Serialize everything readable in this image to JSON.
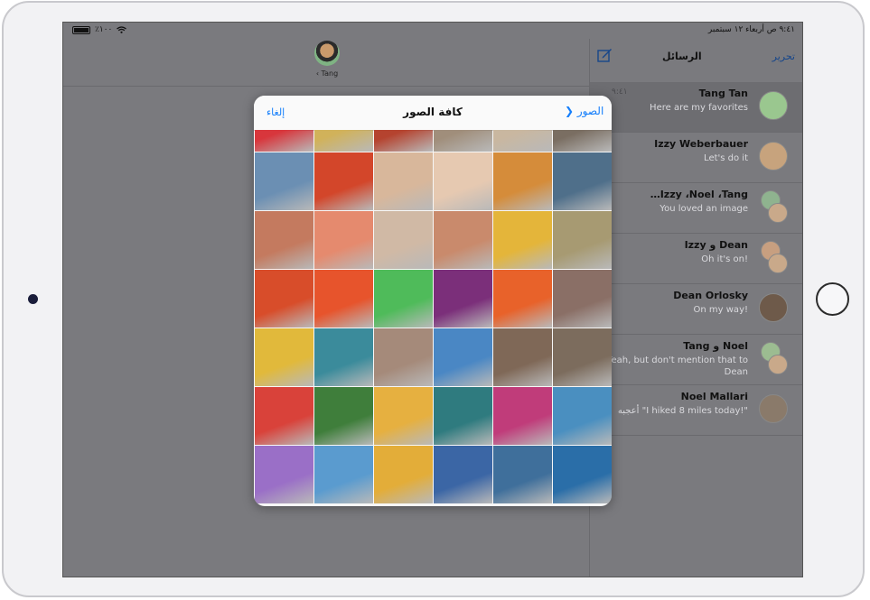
{
  "status_bar": {
    "battery": "٪١٠٠",
    "datetime": "٩:٤١ ص  أربعاء ١٢ سبتمبر"
  },
  "conversation": {
    "contact_name": "‹ Tang"
  },
  "list_header": {
    "title": "الرسائل",
    "edit": "تحرير",
    "compose_icon": "compose-icon"
  },
  "messages": [
    {
      "name": "Tang Tan",
      "preview": "Here are my favorites",
      "time": "٩:٤١",
      "selected": true,
      "avatar_color": "#9ac78f",
      "group": false
    },
    {
      "name": "Izzy Weberbauer",
      "preview": "Let's do it",
      "time": "",
      "selected": false,
      "avatar_color": "#c7a37d",
      "group": false
    },
    {
      "name": "…Izzy ،Noel ،Tang",
      "preview": "You loved an image",
      "time": "",
      "selected": false,
      "avatar_color": "#8fb38f",
      "group": true
    },
    {
      "name": "Izzy و Dean",
      "preview": "Oh it's on!",
      "time": "",
      "selected": false,
      "avatar_color": "#c79f80",
      "group": true
    },
    {
      "name": "Dean Orlosky",
      "preview": "On my way!",
      "time": "",
      "selected": false,
      "avatar_color": "#6e5a4a",
      "group": false
    },
    {
      "name": "Tang و Noel",
      "preview": "Yeah, but don't mention that to Dean",
      "time": "",
      "selected": false,
      "avatar_color": "#9cbc91",
      "group": true
    },
    {
      "name": "Noel Mallari",
      "preview": "أعجبه \"I hiked 8 miles today!\"",
      "time": "",
      "selected": false,
      "avatar_color": "#8a7a6a",
      "group": false
    }
  ],
  "photo_picker": {
    "back_label": "الصور",
    "title": "كافة الصور",
    "cancel_label": "إلغاء"
  },
  "photos": [
    "#7a6e62",
    "#c9b7a0",
    "#a08e7b",
    "#b5432f",
    "#d1b25a",
    "#d8363c",
    "#4f6f8a",
    "#d58c3a",
    "#e6c9b1",
    "#d8b79b",
    "#d3462a",
    "#6b8fb3",
    "#a79a72",
    "#e4b53a",
    "#c98a6c",
    "#d0b9a5",
    "#e58a6e",
    "#c47a5f",
    "#8a6f66",
    "#e8622a",
    "#7b2f7a",
    "#4fbb5a",
    "#e7542c",
    "#d84d2a",
    "#7c6c5d",
    "#7f6857",
    "#4a87c4",
    "#a58a7a",
    "#3b8b9b",
    "#e1b93b",
    "#4a8fc0",
    "#c03c7a",
    "#2f7b7f",
    "#e6b040",
    "#3f7e3b",
    "#d9423a",
    "#2a6ea8",
    "#3f6f9b",
    "#3b66a5",
    "#e3ad39",
    "#5a9bcf",
    "#9a6fc7"
  ]
}
